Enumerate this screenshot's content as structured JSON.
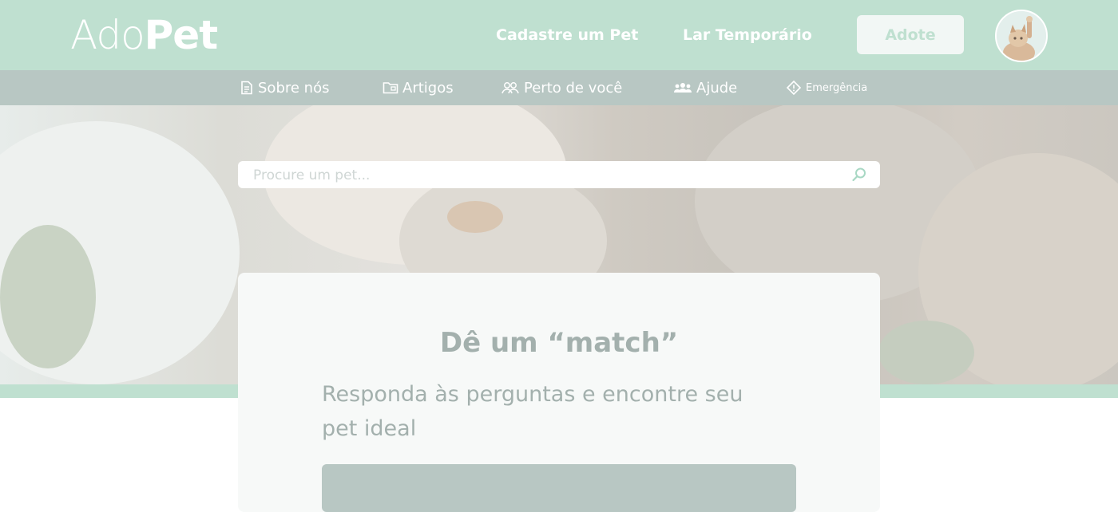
{
  "header": {
    "logo_light": "Ado",
    "logo_bold": "Pet",
    "links": [
      "Cadastre um Pet",
      "Lar Temporário"
    ],
    "adote_label": "Adote"
  },
  "nav": {
    "items": [
      {
        "label": "Sobre nós",
        "icon": "document-icon"
      },
      {
        "label": "Artigos",
        "icon": "folder-icon"
      },
      {
        "label": "Perto de você",
        "icon": "people-location-icon"
      },
      {
        "label": "Ajude",
        "icon": "group-icon"
      },
      {
        "label": "Emergência",
        "icon": "warning-diamond-icon"
      }
    ]
  },
  "search": {
    "placeholder": "Procure um pet..."
  },
  "card": {
    "title": "Dê um “match”",
    "subtitle": "Responda às perguntas e encontre seu pet ideal"
  },
  "colors": {
    "brand_green": "#bfe0d0",
    "nav_gray": "#b8c7c3",
    "card_text": "#a3b0ad"
  }
}
